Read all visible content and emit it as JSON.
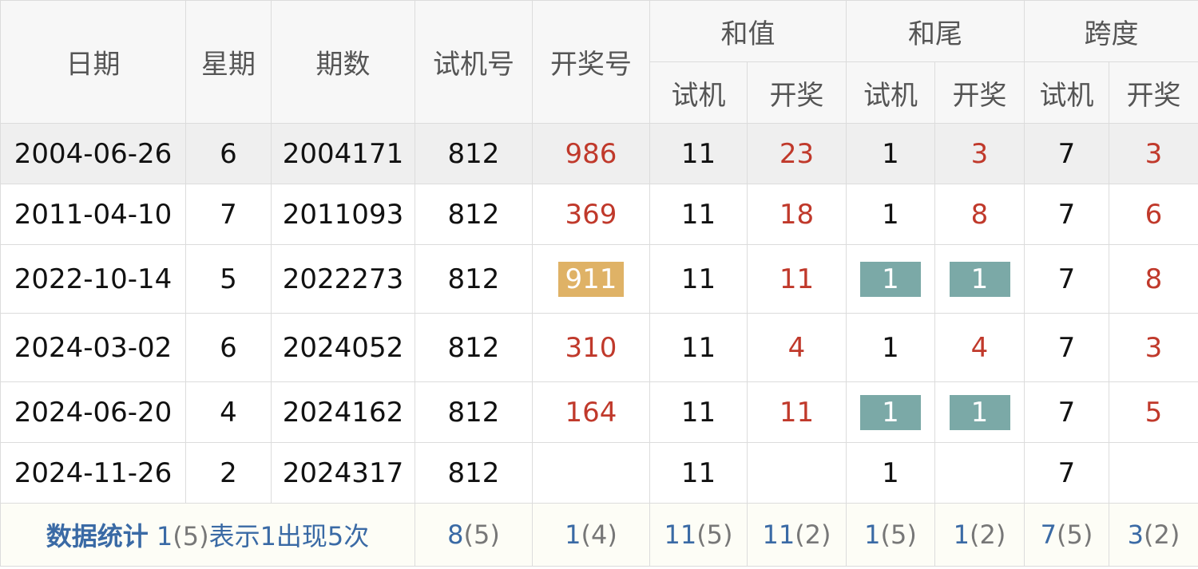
{
  "headers": {
    "date": "日期",
    "weekday": "星期",
    "period": "期数",
    "test_number": "试机号",
    "draw_number": "开奖号",
    "sum": "和值",
    "tail": "和尾",
    "span": "跨度",
    "sub_test": "试机",
    "sub_draw": "开奖"
  },
  "rows": [
    {
      "date": "2004-06-26",
      "weekday": "6",
      "period": "2004171",
      "test": "812",
      "draw": "986",
      "sum_test": "11",
      "sum_draw": "23",
      "tail_test": "1",
      "tail_draw": "3",
      "span_test": "7",
      "span_draw": "3"
    },
    {
      "date": "2011-04-10",
      "weekday": "7",
      "period": "2011093",
      "test": "812",
      "draw": "369",
      "sum_test": "11",
      "sum_draw": "18",
      "tail_test": "1",
      "tail_draw": "8",
      "span_test": "7",
      "span_draw": "6"
    },
    {
      "date": "2022-10-14",
      "weekday": "5",
      "period": "2022273",
      "test": "812",
      "draw": "911",
      "sum_test": "11",
      "sum_draw": "11",
      "tail_test": "1",
      "tail_draw": "1",
      "span_test": "7",
      "span_draw": "8"
    },
    {
      "date": "2024-03-02",
      "weekday": "6",
      "period": "2024052",
      "test": "812",
      "draw": "310",
      "sum_test": "11",
      "sum_draw": "4",
      "tail_test": "1",
      "tail_draw": "4",
      "span_test": "7",
      "span_draw": "3"
    },
    {
      "date": "2024-06-20",
      "weekday": "4",
      "period": "2024162",
      "test": "812",
      "draw": "164",
      "sum_test": "11",
      "sum_draw": "11",
      "tail_test": "1",
      "tail_draw": "1",
      "span_test": "7",
      "span_draw": "5"
    },
    {
      "date": "2024-11-26",
      "weekday": "2",
      "period": "2024317",
      "test": "812",
      "draw": "",
      "sum_test": "11",
      "sum_draw": "",
      "tail_test": "1",
      "tail_draw": "",
      "span_test": "7",
      "span_draw": ""
    }
  ],
  "stats": {
    "title": "数据统计",
    "note_val": "1",
    "note_count": "(5)",
    "note_text": "表示1出现5次",
    "test": {
      "val": "8",
      "count": "(5)"
    },
    "draw": {
      "val": "1",
      "count": "(4)"
    },
    "sum_test": {
      "val": "11",
      "count": "(5)"
    },
    "sum_draw": {
      "val": "11",
      "count": "(2)"
    },
    "tail_test": {
      "val": "1",
      "count": "(5)"
    },
    "tail_draw": {
      "val": "1",
      "count": "(2)"
    },
    "span_test": {
      "val": "7",
      "count": "(5)"
    },
    "span_draw": {
      "val": "3",
      "count": "(2)"
    }
  },
  "colors": {
    "draw_text": "#c0392b",
    "highlight_gold": "#dfb266",
    "highlight_teal": "#7ba9a7",
    "stat_blue": "#3a6aa5",
    "first_row_bg": "#efefef"
  }
}
